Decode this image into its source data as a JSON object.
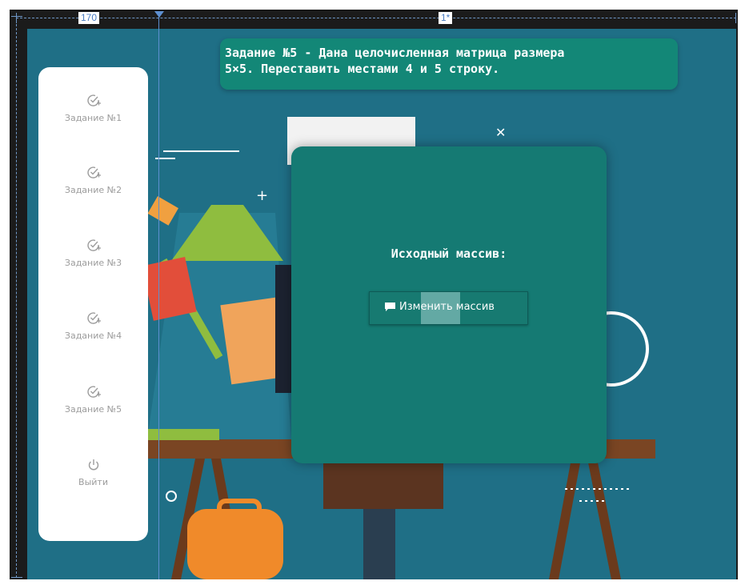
{
  "designer": {
    "column_width_label": "170",
    "column_star_label": "1*"
  },
  "title": {
    "text": "Задание №5 - Дана целочисленная матрица размера\n5×5. Переставить местами 4 и 5 строку."
  },
  "sidebar": {
    "items": [
      {
        "label": "Задание №1",
        "icon": "check-plus-icon"
      },
      {
        "label": "Задание №2",
        "icon": "check-plus-icon"
      },
      {
        "label": "Задание №3",
        "icon": "check-plus-icon"
      },
      {
        "label": "Задание №4",
        "icon": "check-plus-icon"
      },
      {
        "label": "Задание №5",
        "icon": "check-plus-icon"
      },
      {
        "label": "Выйти",
        "icon": "power-icon"
      }
    ]
  },
  "dialog": {
    "label": "Исходный массив:",
    "button_label": "Изменить массив",
    "button_icon": "chat-bubble-icon"
  },
  "colors": {
    "background": "#1f6f86",
    "title_bg": "#138777",
    "dialog_bg": "#157a73",
    "sidebar_bg": "#ffffff"
  }
}
